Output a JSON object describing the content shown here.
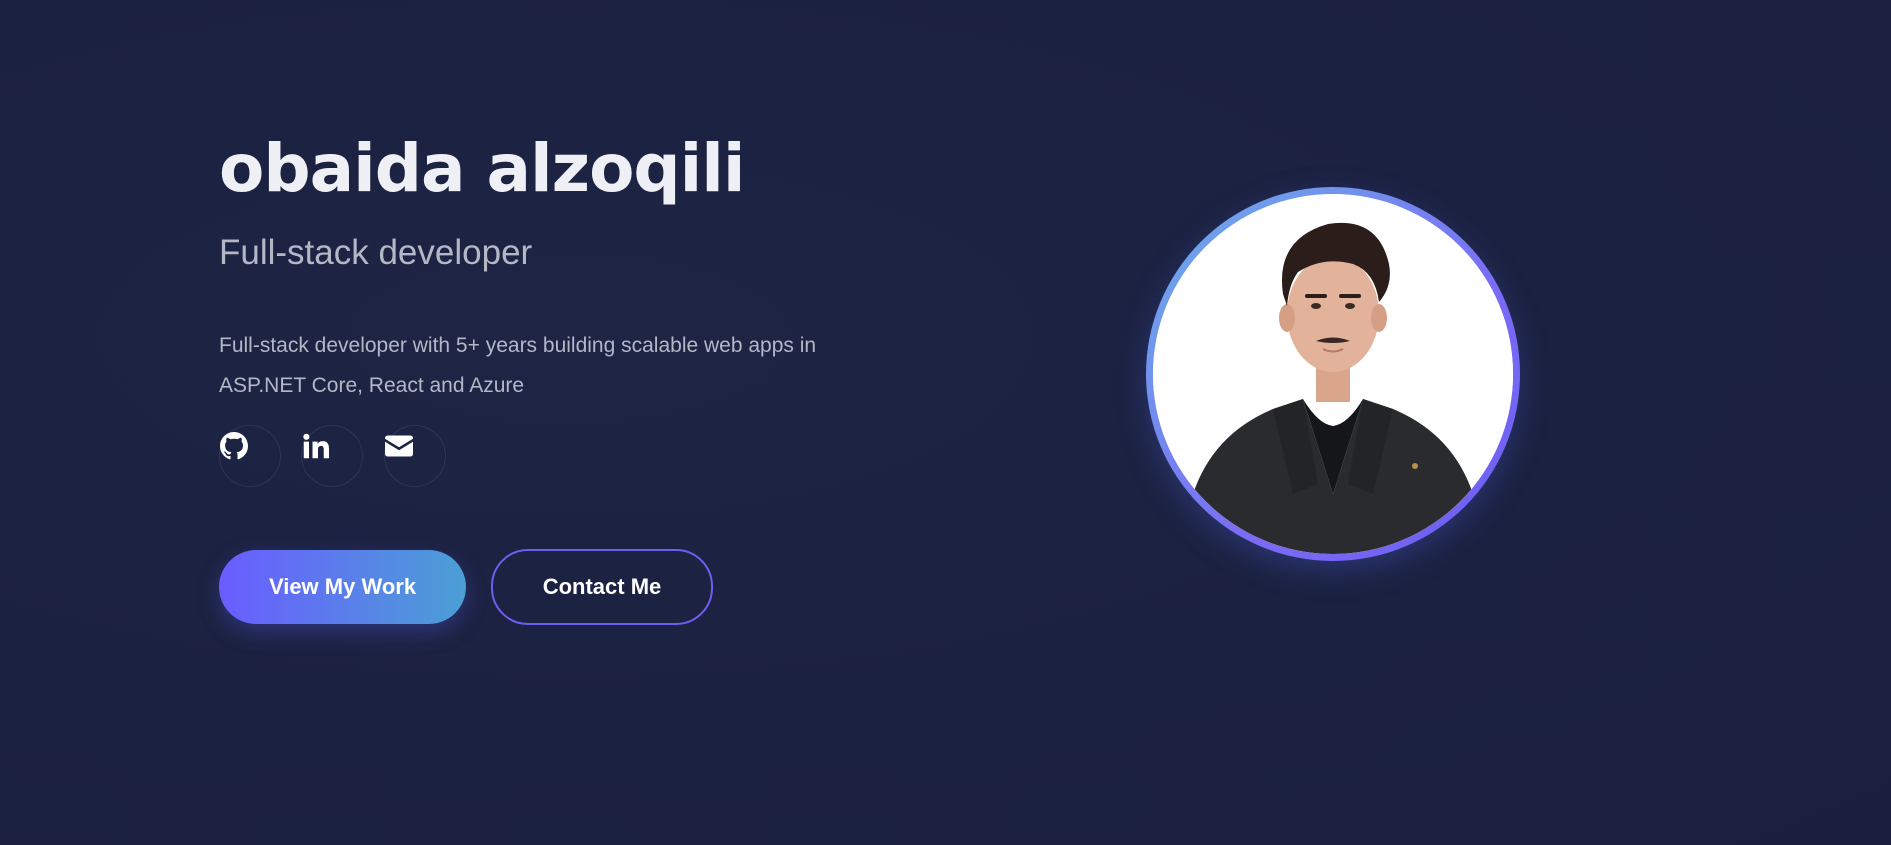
{
  "hero": {
    "name": "obaida alzoqili",
    "role": "Full-stack developer",
    "bio": "Full-stack developer with 5+ years building scalable web apps in ASP.NET Core, React and Azure"
  },
  "socials": [
    {
      "icon": "github-icon"
    },
    {
      "icon": "linkedin-icon"
    },
    {
      "icon": "envelope-icon"
    }
  ],
  "buttons": {
    "primary_label": "View My Work",
    "secondary_label": "Contact Me"
  },
  "colors": {
    "background": "#1b2140",
    "accent_start": "#6a5cff",
    "accent_end": "#4b9fd6",
    "heading": "#eef0f6",
    "muted_text": "#b3b7c6"
  }
}
